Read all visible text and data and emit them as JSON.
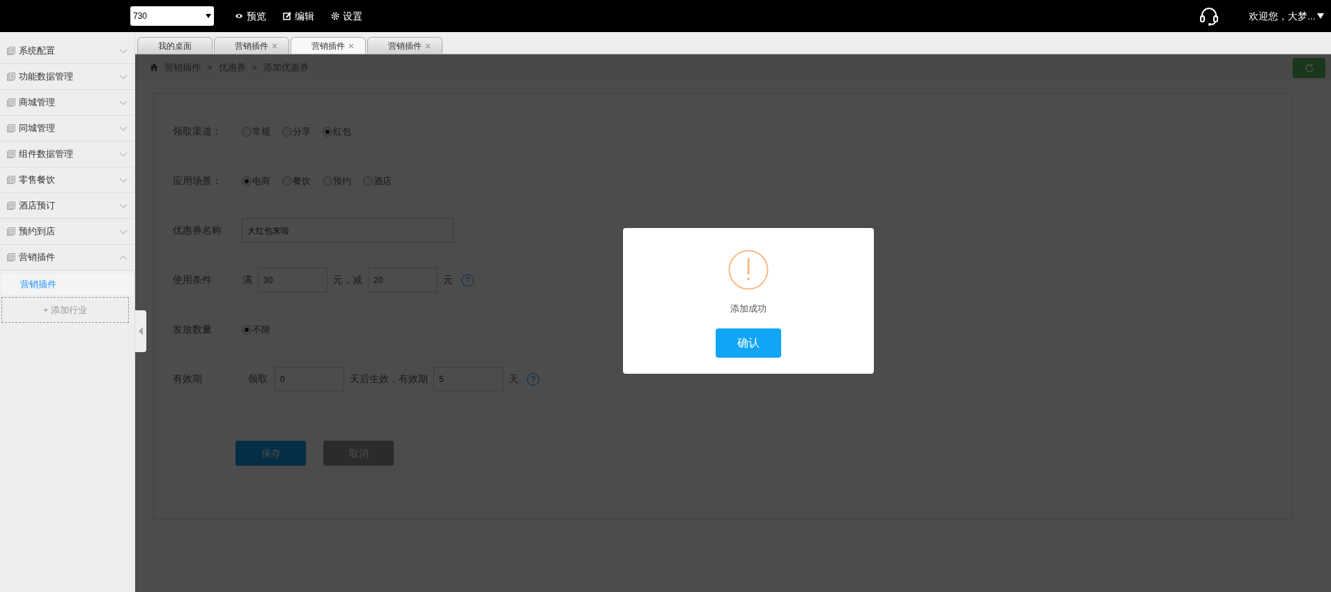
{
  "top_bar": {
    "store_select": "730",
    "menu": [
      {
        "label": "预览"
      },
      {
        "label": "编辑"
      },
      {
        "label": "设置"
      }
    ],
    "user": "欢迎您，大梦..."
  },
  "sidebar": {
    "items": [
      {
        "label": "系统配置",
        "expanded": false
      },
      {
        "label": "功能数据管理",
        "expanded": false
      },
      {
        "label": "商城管理",
        "expanded": false
      },
      {
        "label": "同城管理",
        "expanded": false
      },
      {
        "label": "组件数据管理",
        "expanded": false
      },
      {
        "label": "零售餐饮",
        "expanded": false
      },
      {
        "label": "酒店预订",
        "expanded": false
      },
      {
        "label": "预约到店",
        "expanded": false
      },
      {
        "label": "营销插件",
        "expanded": true,
        "children": [
          {
            "label": "营销插件",
            "selected": true
          }
        ]
      }
    ],
    "add_button": "+ 添加行业"
  },
  "tabs": [
    {
      "label": "我的桌面",
      "selected": false,
      "closable": false
    },
    {
      "label": "营销插件",
      "selected": false,
      "closable": true
    },
    {
      "label": "营销插件",
      "selected": true,
      "closable": true
    },
    {
      "label": "营销插件",
      "selected": false,
      "closable": true
    }
  ],
  "breadcrumb": [
    "营销插件",
    ">",
    "优惠券",
    ">",
    "添加优惠券"
  ],
  "form": {
    "rows": [
      {
        "kind": "radio",
        "label": "领取渠道：",
        "options": [
          {
            "label": "常规",
            "selected": false
          },
          {
            "label": "分享",
            "selected": false
          },
          {
            "label": "红包",
            "selected": true
          }
        ]
      },
      {
        "kind": "radio",
        "label": "应用场景：",
        "options": [
          {
            "label": "电商",
            "selected": true
          },
          {
            "label": "餐饮",
            "selected": false
          },
          {
            "label": "预约",
            "selected": false
          },
          {
            "label": "酒店",
            "selected": false
          }
        ]
      },
      {
        "kind": "text",
        "label": "优惠券名称",
        "value": "大红包来啦"
      },
      {
        "kind": "inline",
        "label": "使用条件",
        "parts": [
          {
            "kind": "text",
            "text": "满"
          },
          {
            "kind": "input",
            "value": "30"
          },
          {
            "kind": "text",
            "text": "元，减"
          },
          {
            "kind": "input",
            "value": "20"
          },
          {
            "kind": "text",
            "text": "元"
          },
          {
            "kind": "help",
            "text": "?"
          }
        ]
      },
      {
        "kind": "radio",
        "label": "发放数量",
        "options": [
          {
            "label": "不限",
            "selected": true
          }
        ]
      },
      {
        "kind": "inline",
        "label": "有效期",
        "parts": [
          {
            "kind": "text",
            "text": "领取"
          },
          {
            "kind": "input",
            "value": "0"
          },
          {
            "kind": "text",
            "text": "天后生效，有效期"
          },
          {
            "kind": "input",
            "value": "5"
          },
          {
            "kind": "text",
            "text": "天"
          },
          {
            "kind": "help",
            "text": "?"
          }
        ]
      }
    ],
    "buttons": [
      {
        "kind": "primary",
        "label": "保存"
      },
      {
        "kind": "secondary",
        "label": "取消"
      }
    ]
  },
  "dialog": {
    "message": "添加成功",
    "button": "确认"
  }
}
